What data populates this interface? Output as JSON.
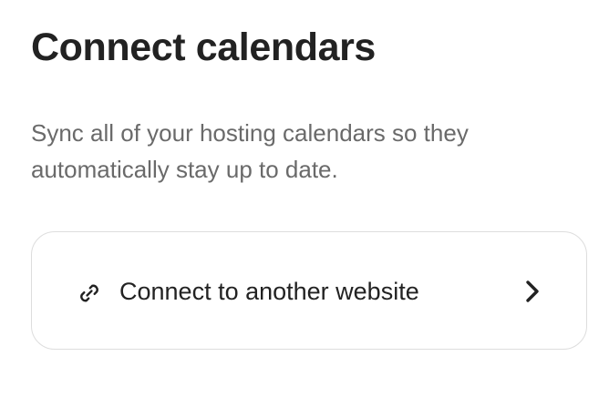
{
  "header": {
    "title": "Connect calendars"
  },
  "main": {
    "description": "Sync all of your hosting calendars so they automatically stay up to date.",
    "connect_option": {
      "label": "Connect to another website",
      "leading_icon": "link-icon",
      "trailing_icon": "chevron-right-icon"
    }
  },
  "colors": {
    "text_primary": "#222222",
    "text_secondary": "#6a6a6a",
    "card_border": "#dddddd",
    "background": "#ffffff"
  }
}
